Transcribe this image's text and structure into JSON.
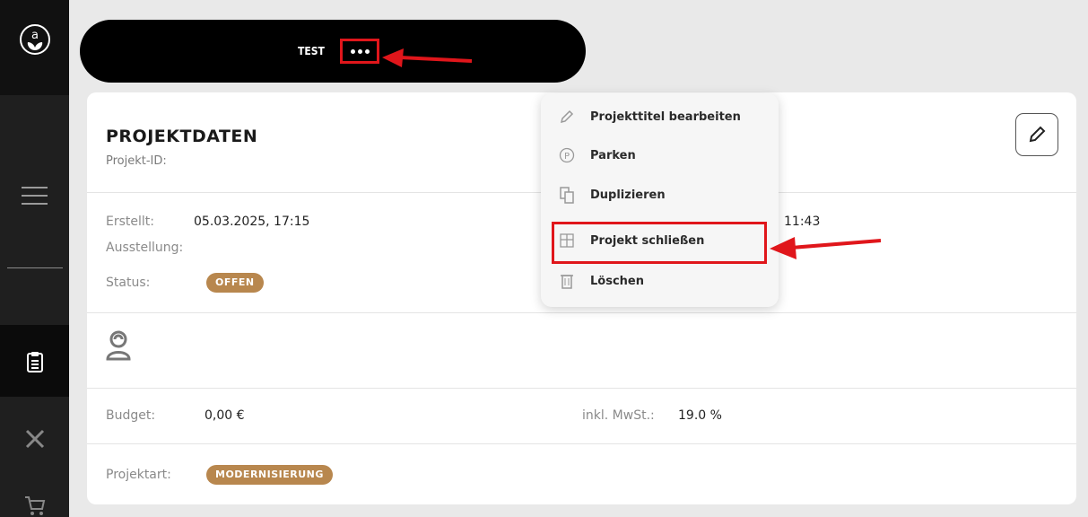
{
  "header": {
    "title": "TEST"
  },
  "project": {
    "section_title": "PROJEKTDATEN",
    "id_label": "Projekt-ID:",
    "created_label": "Erstellt:",
    "created_value": "05.03.2025, 17:15",
    "exhibition_label": "Ausstellung:",
    "status_label": "Status:",
    "status_value": "OFFEN",
    "other_time": "11:43",
    "budget_label": "Budget:",
    "budget_value": "0,00 €",
    "vat_label": "inkl. MwSt.:",
    "vat_value": "19.0 %",
    "type_label": "Projektart:",
    "type_value": "MODERNISIERUNG"
  },
  "menu": {
    "items": [
      {
        "label": "Projekttitel bearbeiten",
        "icon": "pencil-icon"
      },
      {
        "label": "Parken",
        "icon": "parking-icon"
      },
      {
        "label": "Duplizieren",
        "icon": "duplicate-icon"
      },
      {
        "label": "Projekt schließen",
        "icon": "close-project-icon"
      },
      {
        "label": "Löschen",
        "icon": "trash-icon"
      }
    ]
  },
  "colors": {
    "badge": "#b8874e",
    "annotation": "#e0161b",
    "sidebar": "#1f1f1f"
  }
}
